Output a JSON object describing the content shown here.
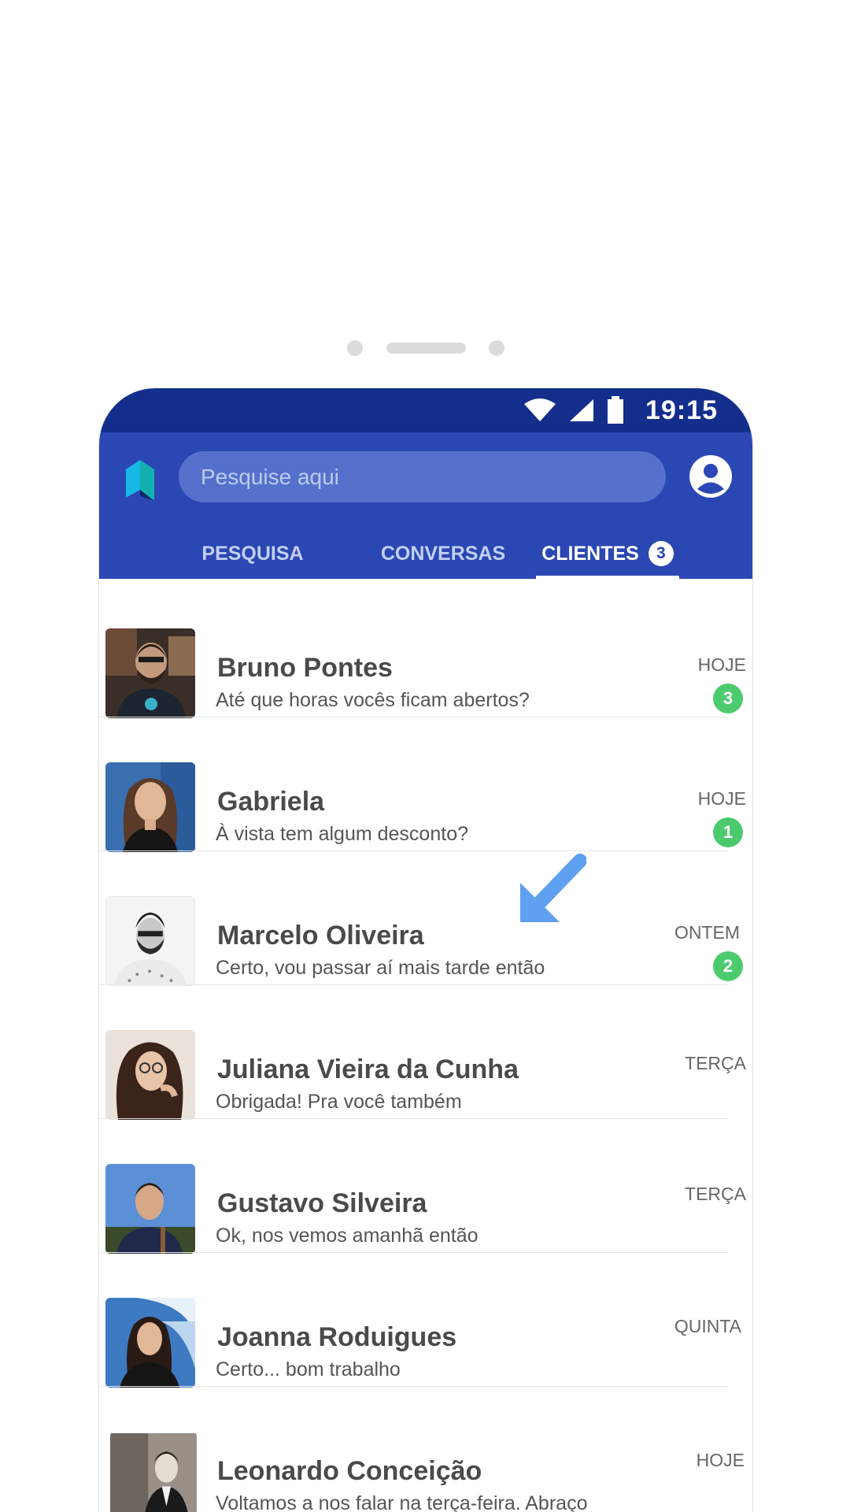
{
  "status": {
    "time": "19:15"
  },
  "header": {
    "search_placeholder": "Pesquise aqui"
  },
  "tabs": [
    {
      "label": "PESQUISA"
    },
    {
      "label": "CONVERSAS"
    },
    {
      "label": "CLIENTES",
      "badge": "3",
      "active": true
    }
  ],
  "contacts": [
    {
      "name": "Bruno Pontes",
      "message": "Até que horas vocês ficam abertos?",
      "day": "HOJE",
      "unread": "3"
    },
    {
      "name": "Gabriela",
      "message": "À vista tem algum desconto?",
      "day": "HOJE",
      "unread": "1"
    },
    {
      "name": "Marcelo Oliveira",
      "message": "Certo, vou passar aí mais tarde então",
      "day": "ONTEM",
      "unread": "2"
    },
    {
      "name": "Juliana Vieira da Cunha",
      "message": "Obrigada! Pra você também",
      "day": "TERÇA"
    },
    {
      "name": "Gustavo Silveira",
      "message": "Ok, nos vemos amanhã então",
      "day": "TERÇA"
    },
    {
      "name": "Joanna Roduigues",
      "message": "Certo... bom trabalho",
      "day": "QUINTA"
    },
    {
      "name": "Leonardo Conceição",
      "message": "Voltamos a nos falar na terça-feira. Abraço",
      "day": "HOJE"
    }
  ],
  "colors": {
    "statusbar": "#142e8c",
    "appbar": "#2a47b4",
    "search_field": "#5571cc",
    "unread_badge": "#4ccb6e",
    "pointer_arrow": "#5fa0f0"
  }
}
